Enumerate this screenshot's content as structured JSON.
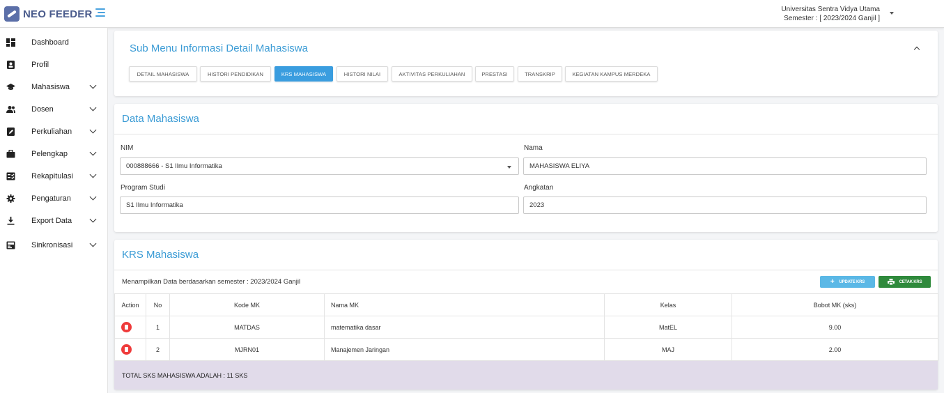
{
  "header": {
    "app_name": "NEO FEEDER",
    "university": "Universitas Sentra Vidya Utama",
    "semester": "Semester : [ 2023/2024 Ganjil ]"
  },
  "sidebar": {
    "items": [
      {
        "label": "Dashboard",
        "icon": "dashboard-icon",
        "has_chevron": false
      },
      {
        "label": "Profil",
        "icon": "profile-icon",
        "has_chevron": false
      },
      {
        "label": "Mahasiswa",
        "icon": "graduation-cap-icon",
        "has_chevron": true
      },
      {
        "label": "Dosen",
        "icon": "users-icon",
        "has_chevron": true
      },
      {
        "label": "Perkuliahan",
        "icon": "edit-icon",
        "has_chevron": true
      },
      {
        "label": "Pelengkap",
        "icon": "briefcase-icon",
        "has_chevron": true
      },
      {
        "label": "Rekapitulasi",
        "icon": "checklist-icon",
        "has_chevron": true
      },
      {
        "label": "Pengaturan",
        "icon": "gear-icon",
        "has_chevron": true
      },
      {
        "label": "Export Data",
        "icon": "download-icon",
        "has_chevron": true
      },
      {
        "label": "Sinkronisasi",
        "icon": "sync-icon",
        "has_chevron": true
      }
    ]
  },
  "submenu": {
    "title": "Sub Menu Informasi Detail Mahasiswa",
    "tabs": [
      {
        "label": "DETAIL MAHASISWA",
        "active": false
      },
      {
        "label": "HISTORI PENDIDIKAN",
        "active": false
      },
      {
        "label": "KRS MAHASISWA",
        "active": true
      },
      {
        "label": "HISTORI NILAI",
        "active": false
      },
      {
        "label": "AKTIVITAS PERKULIAHAN",
        "active": false
      },
      {
        "label": "PRESTASI",
        "active": false
      },
      {
        "label": "TRANSKRIP",
        "active": false
      },
      {
        "label": "KEGIATAN KAMPUS MERDEKA",
        "active": false
      }
    ]
  },
  "data_mahasiswa": {
    "title": "Data Mahasiswa",
    "nim_label": "NIM",
    "nim_value": "000888666 - S1 Ilmu Informatika",
    "nama_label": "Nama",
    "nama_value": "MAHASISWA ELIYA",
    "prodi_label": "Program Studi",
    "prodi_value": "S1 Ilmu Informatika",
    "angkatan_label": "Angkatan",
    "angkatan_value": "2023"
  },
  "krs": {
    "title": "KRS Mahasiswa",
    "info": "Menampilkan Data berdasarkan semester : 2023/2024 Ganjil",
    "update_button": "UPDATE KRS",
    "print_button": "CETAK KRS",
    "columns": [
      "Action",
      "No",
      "Kode MK",
      "Nama MK",
      "Kelas",
      "Bobot MK (sks)"
    ],
    "rows": [
      {
        "no": "1",
        "kode": "MATDAS",
        "nama": "matematika dasar",
        "kelas": "MatEL",
        "bobot": "9.00"
      },
      {
        "no": "2",
        "kode": "MJRN01",
        "nama": "Manajemen Jaringan",
        "kelas": "MAJ",
        "bobot": "2.00"
      }
    ],
    "total": "TOTAL SKS MAHASISWA ADALAH : 11 SKS"
  }
}
